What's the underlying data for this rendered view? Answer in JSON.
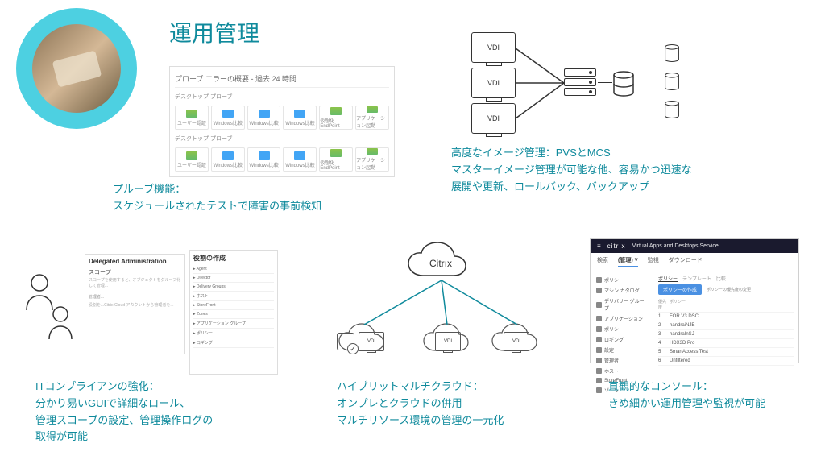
{
  "title": "運用管理",
  "probe": {
    "header": "プローブ エラーの概要 - 過去 24 時間",
    "subheader": "デスクトップ プローブ",
    "cells": [
      {
        "label": "ユーザー認証"
      },
      {
        "label": "Windows比較"
      },
      {
        "label": "Windows比較"
      },
      {
        "label": "Windows比較"
      },
      {
        "label": "仮想化EndPoint"
      },
      {
        "label": "アプリケーション起動"
      }
    ],
    "section2": "デスクトップ プローブ",
    "text_line1": "プルーブ機能：",
    "text_line2": "スケジュールされたテストで障害の事前検知"
  },
  "imgmt": {
    "vdi_label": "VDI",
    "text_line1": "高度なイメージ管理：PVSとMCS",
    "text_line2": "マスターイメージ管理が可能な他、容易かつ迅速な",
    "text_line3": "展開や更新、ロールバック、バックアップ"
  },
  "compliance": {
    "dlg1_title": "Delegated Administration",
    "dlg1_section": "スコープ",
    "dlg2_title": "役割の作成",
    "rows": [
      "Agent",
      "Director",
      "Delivery Groups",
      "ホスト",
      "StoreFront",
      "Zones",
      "アプリケーション グループ",
      "ポリシー",
      "ロギング"
    ],
    "text_line1": "ITコンプライアンの強化：",
    "text_line2": "分かり易いGUIで詳細なロール、",
    "text_line3": "管理スコープの設定、管理操作ログの",
    "text_line4": "取得が可能"
  },
  "hybrid": {
    "cloud_label": "Citrıx",
    "vdi_label": "VDI",
    "text_line1": "ハイブリットマルチクラウド：",
    "text_line2": "オンプレとクラウドの併用",
    "text_line3": "マルチリソース環境の管理の一元化"
  },
  "console": {
    "brand": "citrıx",
    "title": "Virtual Apps and Desktops Service",
    "tabs": [
      "検索",
      "(管理) ˅",
      "監視",
      "ダウンロード"
    ],
    "side": [
      "ポリシー",
      "マシン カタログ",
      "デリバリー グループ",
      "アプリケーション",
      "ポリシー",
      "ロギング",
      "設定",
      "管理者",
      "ホスト",
      "StoreFront",
      "ゾーン"
    ],
    "main_hdr_tabs": [
      "ポリシー",
      "テンプレート",
      "比較"
    ],
    "create_btn": "ポリシーの作成",
    "breadcrumb": "ポリシーの優先度の変更",
    "col_hdr1": "優先度",
    "col_hdr2": "ポリシー",
    "rows": [
      {
        "n": "1",
        "name": "FOR V3 DSC"
      },
      {
        "n": "2",
        "name": "handraiNJE"
      },
      {
        "n": "3",
        "name": "handraInSJ"
      },
      {
        "n": "4",
        "name": "HDX3D Pro"
      },
      {
        "n": "5",
        "name": "SmartAccess Test"
      },
      {
        "n": "6",
        "name": "Unfiltered"
      }
    ],
    "text_line1": "直観的なコンソール：",
    "text_line2": "きめ細かい運用管理や監視が可能"
  }
}
